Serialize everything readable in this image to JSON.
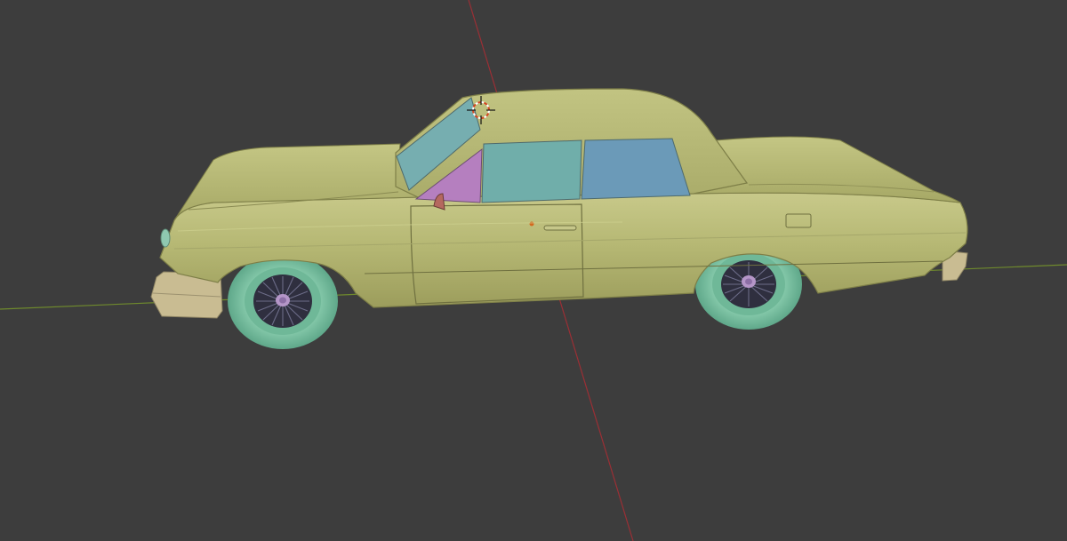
{
  "viewport": {
    "name": "3D Viewport",
    "background": "#3d3d3d"
  },
  "axes": {
    "x_axis_color": "#9b2f35",
    "y_axis_color": "#6f8a2d"
  },
  "scene": {
    "object": "car-body",
    "body_color": "#b9bb78",
    "glass_color_front": "#76aeb0",
    "glass_color_rear": "#6f9db7",
    "vent_glass_color": "#b87fbf",
    "tire_color": "#7fc4a6",
    "wheel_spoke_color": "#5a5a74",
    "bumper_color": "#c4b88f"
  },
  "cursor_3d": {
    "icon": "3d-cursor-icon"
  }
}
